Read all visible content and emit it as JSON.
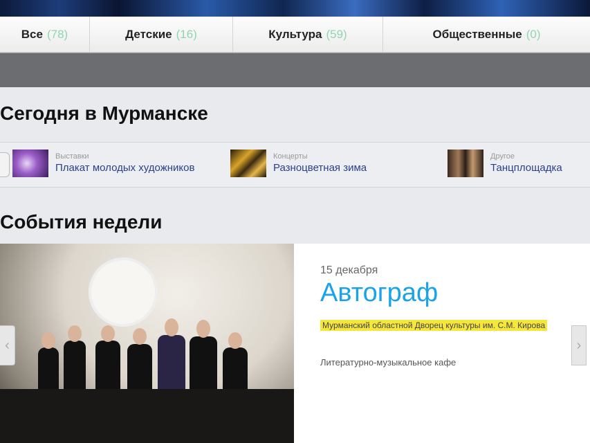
{
  "tabs": [
    {
      "label": "Все",
      "count": "(78)"
    },
    {
      "label": "Детские",
      "count": "(16)"
    },
    {
      "label": "Культура",
      "count": "(59)"
    },
    {
      "label": "Общественные",
      "count": "(0)"
    }
  ],
  "today": {
    "heading": "Сегодня в Мурманске",
    "items": [
      {
        "category": "Выставки",
        "title": "Плакат молодых художников"
      },
      {
        "category": "Концерты",
        "title": "Разноцветная зима"
      },
      {
        "category": "Другое",
        "title": "Танцплощадка"
      }
    ]
  },
  "week": {
    "heading": "События недели",
    "event": {
      "date": "15 декабря",
      "title": "Автограф",
      "venue": "Мурманский областной Дворец культуры им. С.М. Кирова",
      "description": "Литературно-музыкальное кафе"
    }
  },
  "colors": {
    "accent": "#1aa3e8",
    "count": "#8fd6ae",
    "highlight": "#f5e63c"
  }
}
